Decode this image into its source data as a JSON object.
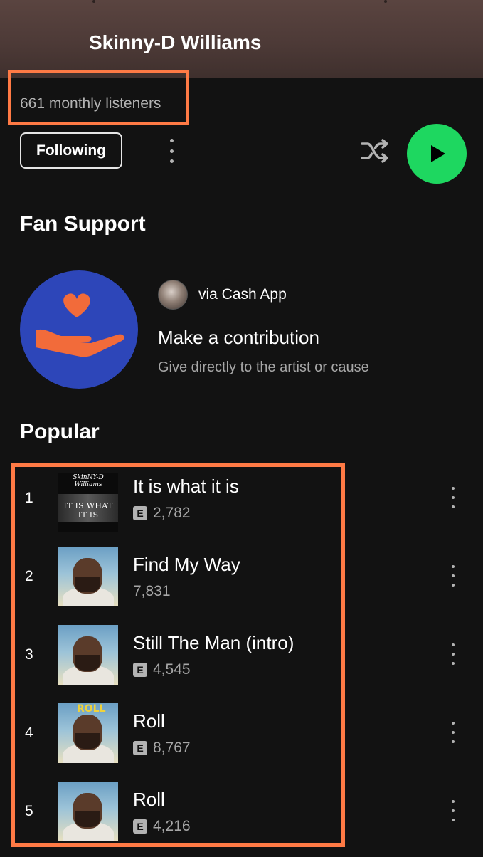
{
  "artist": {
    "name": "Skinny-D Williams",
    "monthly_listeners": "661 monthly listeners"
  },
  "actions": {
    "follow_label": "Following"
  },
  "fan_support": {
    "heading": "Fan Support",
    "via": "via Cash App",
    "title": "Make a contribution",
    "subtitle": "Give directly to the artist or cause"
  },
  "popular": {
    "heading": "Popular",
    "tracks": [
      {
        "num": "1",
        "title": "It is what it is",
        "plays": "2,782",
        "explicit": true,
        "cover_header": "SkinNY-D Williams",
        "cover_text": "IT IS WHAT IT IS"
      },
      {
        "num": "2",
        "title": "Find My Way",
        "plays": "7,831",
        "explicit": false
      },
      {
        "num": "3",
        "title": "Still The Man (intro)",
        "plays": "4,545",
        "explicit": true
      },
      {
        "num": "4",
        "title": "Roll",
        "plays": "8,767",
        "explicit": true,
        "cover_text": "ROLL"
      },
      {
        "num": "5",
        "title": "Roll",
        "plays": "4,216",
        "explicit": true
      }
    ],
    "explicit_badge": "E"
  },
  "colors": {
    "accent_green": "#1ed760",
    "highlight_orange": "#ff7a45",
    "background": "#121212"
  },
  "icons": {
    "more": "more-vertical-icon",
    "shuffle": "shuffle-icon",
    "play": "play-icon",
    "fan_support": "heart-in-hand-icon"
  }
}
